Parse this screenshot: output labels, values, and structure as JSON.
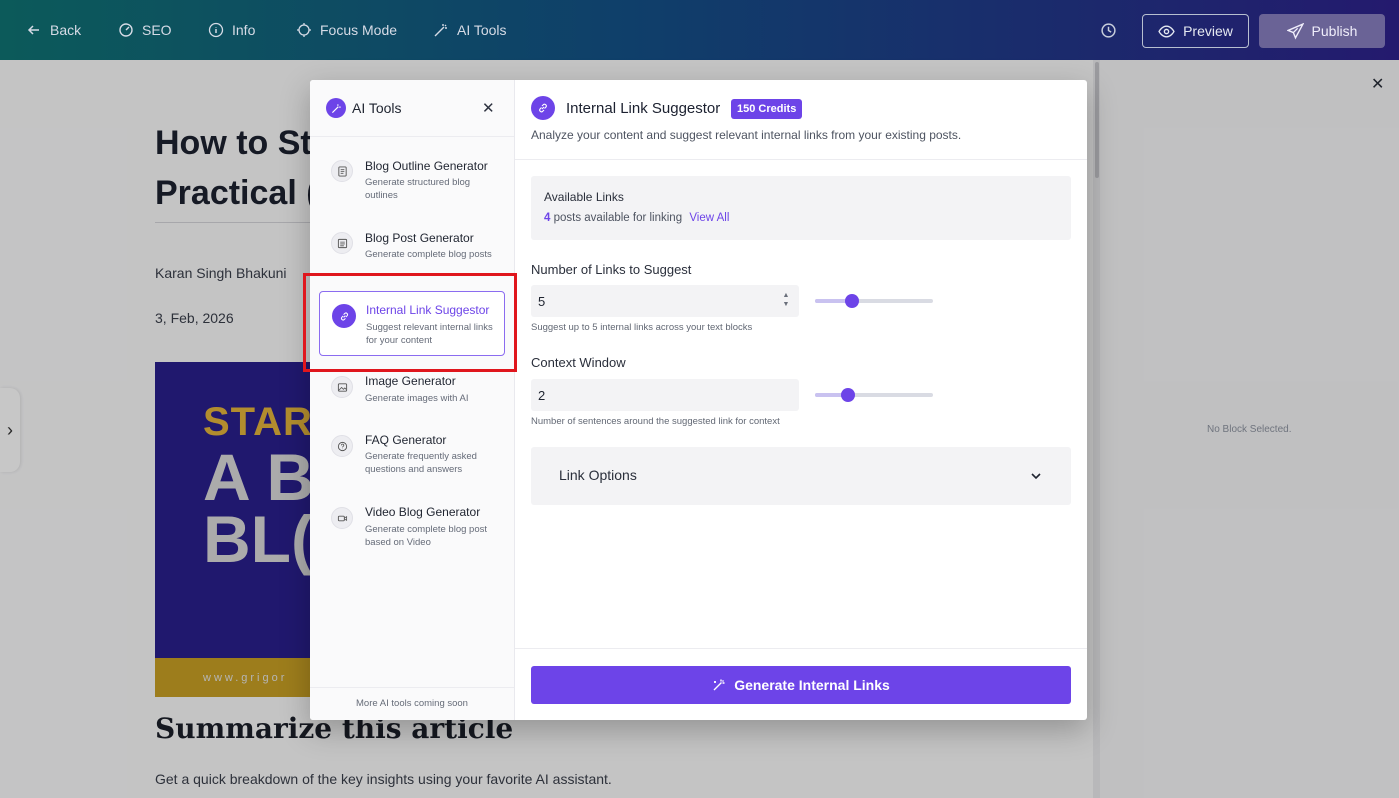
{
  "topbar": {
    "back": "Back",
    "seo": "SEO",
    "info": "Info",
    "focus_mode": "Focus Mode",
    "ai_tools": "AI Tools",
    "preview": "Preview",
    "publish": "Publish"
  },
  "article": {
    "title_line1": "How to St",
    "title_line2": "Practical (",
    "author": "Karan Singh Bhakuni",
    "date": "3, Feb, 2026",
    "hero_text1": "STAR",
    "hero_text2": "A B\nBL(",
    "hero_url": "www.grigor",
    "summary_heading": "Summarize this article",
    "summary_text": "Get a quick breakdown of the key insights using your favorite AI assistant."
  },
  "right_panel": {
    "empty_text": "No Block Selected."
  },
  "modal": {
    "sidebar_title": "AI Tools",
    "tools": [
      {
        "name": "Blog Outline Generator",
        "desc": "Generate structured blog outlines",
        "icon": "document-icon"
      },
      {
        "name": "Blog Post Generator",
        "desc": "Generate complete blog posts",
        "icon": "list-icon"
      },
      {
        "name": "Internal Link Suggestor",
        "desc": "Suggest relevant internal links for your content",
        "icon": "link-icon"
      },
      {
        "name": "Image Generator",
        "desc": "Generate images with AI",
        "icon": "image-icon"
      },
      {
        "name": "FAQ Generator",
        "desc": "Generate frequently asked questions and answers",
        "icon": "question-icon"
      },
      {
        "name": "Video Blog Generator",
        "desc": "Generate complete blog post based on Video",
        "icon": "video-icon"
      }
    ],
    "sidebar_footer": "More AI tools coming soon",
    "main": {
      "title": "Internal Link Suggestor",
      "credits": "150 Credits",
      "subtitle": "Analyze your content and suggest relevant internal links from your existing posts.",
      "available": {
        "title": "Available Links",
        "count": "4",
        "text": "posts available for linking",
        "link": "View All"
      },
      "num_links": {
        "label": "Number of Links to Suggest",
        "value": "5",
        "helper": "Suggest up to 5 internal links across your text blocks",
        "slider_fraction": 0.31
      },
      "context_window": {
        "label": "Context Window",
        "value": "2",
        "helper": "Number of sentences around the suggested link for context",
        "slider_fraction": 0.28
      },
      "link_options": "Link Options",
      "generate": "Generate Internal Links"
    }
  },
  "colors": {
    "accent": "#6d44e8",
    "highlight": "#e0161d"
  }
}
